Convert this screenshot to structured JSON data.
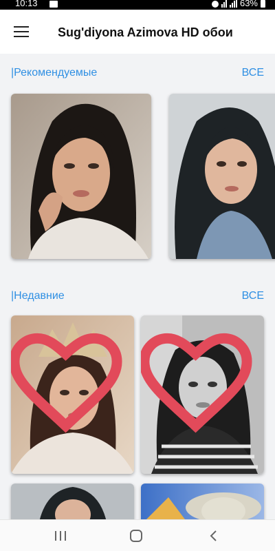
{
  "status_bar": {
    "time": "10:13",
    "battery": "63%"
  },
  "app_bar": {
    "title": "Sug'diyona Azimova HD обои"
  },
  "sections": {
    "recommended": {
      "title": "|Рекомендуемые",
      "see_all": "ВСЕ"
    },
    "recent": {
      "title": "|Недавние",
      "see_all": "ВСЕ"
    }
  },
  "colors": {
    "accent": "#2f8fe3",
    "favorite": "#e24a5a"
  },
  "icons": {
    "menu": "menu-icon",
    "favorite": "heart-outline-icon",
    "recents": "recents-icon",
    "home": "home-icon",
    "back": "back-icon"
  }
}
